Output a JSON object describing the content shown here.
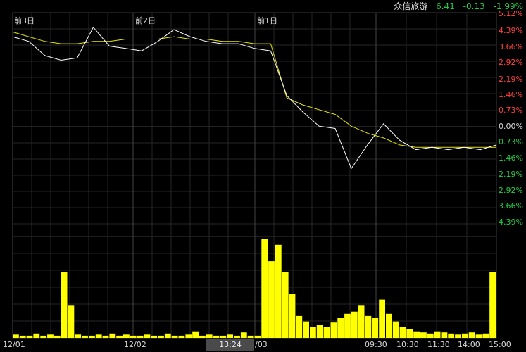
{
  "header": {
    "stock_name": "众信旅游",
    "price": "6.41",
    "change": "-0.13",
    "change_pct": "-1.99%"
  },
  "day_labels": [
    "前3日",
    "前2日",
    "前1日"
  ],
  "y_axis_labels": [
    "5.12%",
    "4.39%",
    "3.66%",
    "2.92%",
    "2.19%",
    "1.46%",
    "0.73%",
    "0.00%",
    "0.73%",
    "1.46%",
    "2.19%",
    "2.92%",
    "3.66%",
    "4.39%"
  ],
  "x_axis_labels": [
    "12/01",
    "12/02",
    "/03",
    "09:30",
    "10:30",
    "11:30",
    "14:00",
    "15:00"
  ],
  "cursor_time": "13:24",
  "colors": {
    "up": "#ff4040",
    "down": "#22cc44",
    "price_line": "#ffffff",
    "avg_line": "#e8e800",
    "volume": "#ffff00",
    "grid": "#262626",
    "grid_major": "#444444",
    "frame": "#3a3a3a"
  },
  "chart_data": {
    "type": "line",
    "y_unit": "percent change",
    "ylim": [
      -4.39,
      5.12
    ],
    "days": [
      "前3日",
      "前2日",
      "前1日",
      "today"
    ],
    "series": [
      {
        "values": [
          4.1,
          3.9,
          3.3,
          3.1,
          3.2,
          4.5,
          3.7,
          3.6,
          3.5,
          3.9,
          4.4,
          4.1,
          3.9,
          3.8,
          3.8,
          3.6,
          3.5,
          1.6,
          0.9,
          0.3,
          0.2,
          -1.5,
          -0.5,
          0.4,
          -0.3,
          -0.7,
          -0.6,
          -0.7,
          -0.6,
          -0.7,
          -0.5
        ]
      },
      {
        "values": [
          4.3,
          4.1,
          3.9,
          3.8,
          3.8,
          3.9,
          3.9,
          4.0,
          4.0,
          4.0,
          4.1,
          4.0,
          4.0,
          3.9,
          3.9,
          3.8,
          3.8,
          1.5,
          1.2,
          1.0,
          0.8,
          0.3,
          0.0,
          -0.2,
          -0.5,
          -0.6,
          -0.6,
          -0.6,
          -0.6,
          -0.6,
          -0.6
        ]
      }
    ],
    "volume": [
      3,
      2,
      2,
      4,
      2,
      3,
      2,
      60,
      30,
      3,
      2,
      2,
      3,
      2,
      4,
      2,
      3,
      2,
      2,
      3,
      2,
      2,
      4,
      2,
      2,
      3,
      6,
      2,
      3,
      2,
      2,
      3,
      2,
      5,
      2,
      2,
      90,
      70,
      85,
      60,
      40,
      20,
      15,
      10,
      12,
      10,
      14,
      18,
      22,
      24,
      30,
      20,
      18,
      35,
      22,
      15,
      10,
      8,
      6,
      5,
      4,
      6,
      5,
      4,
      3,
      4,
      5,
      3,
      4,
      60
    ]
  }
}
